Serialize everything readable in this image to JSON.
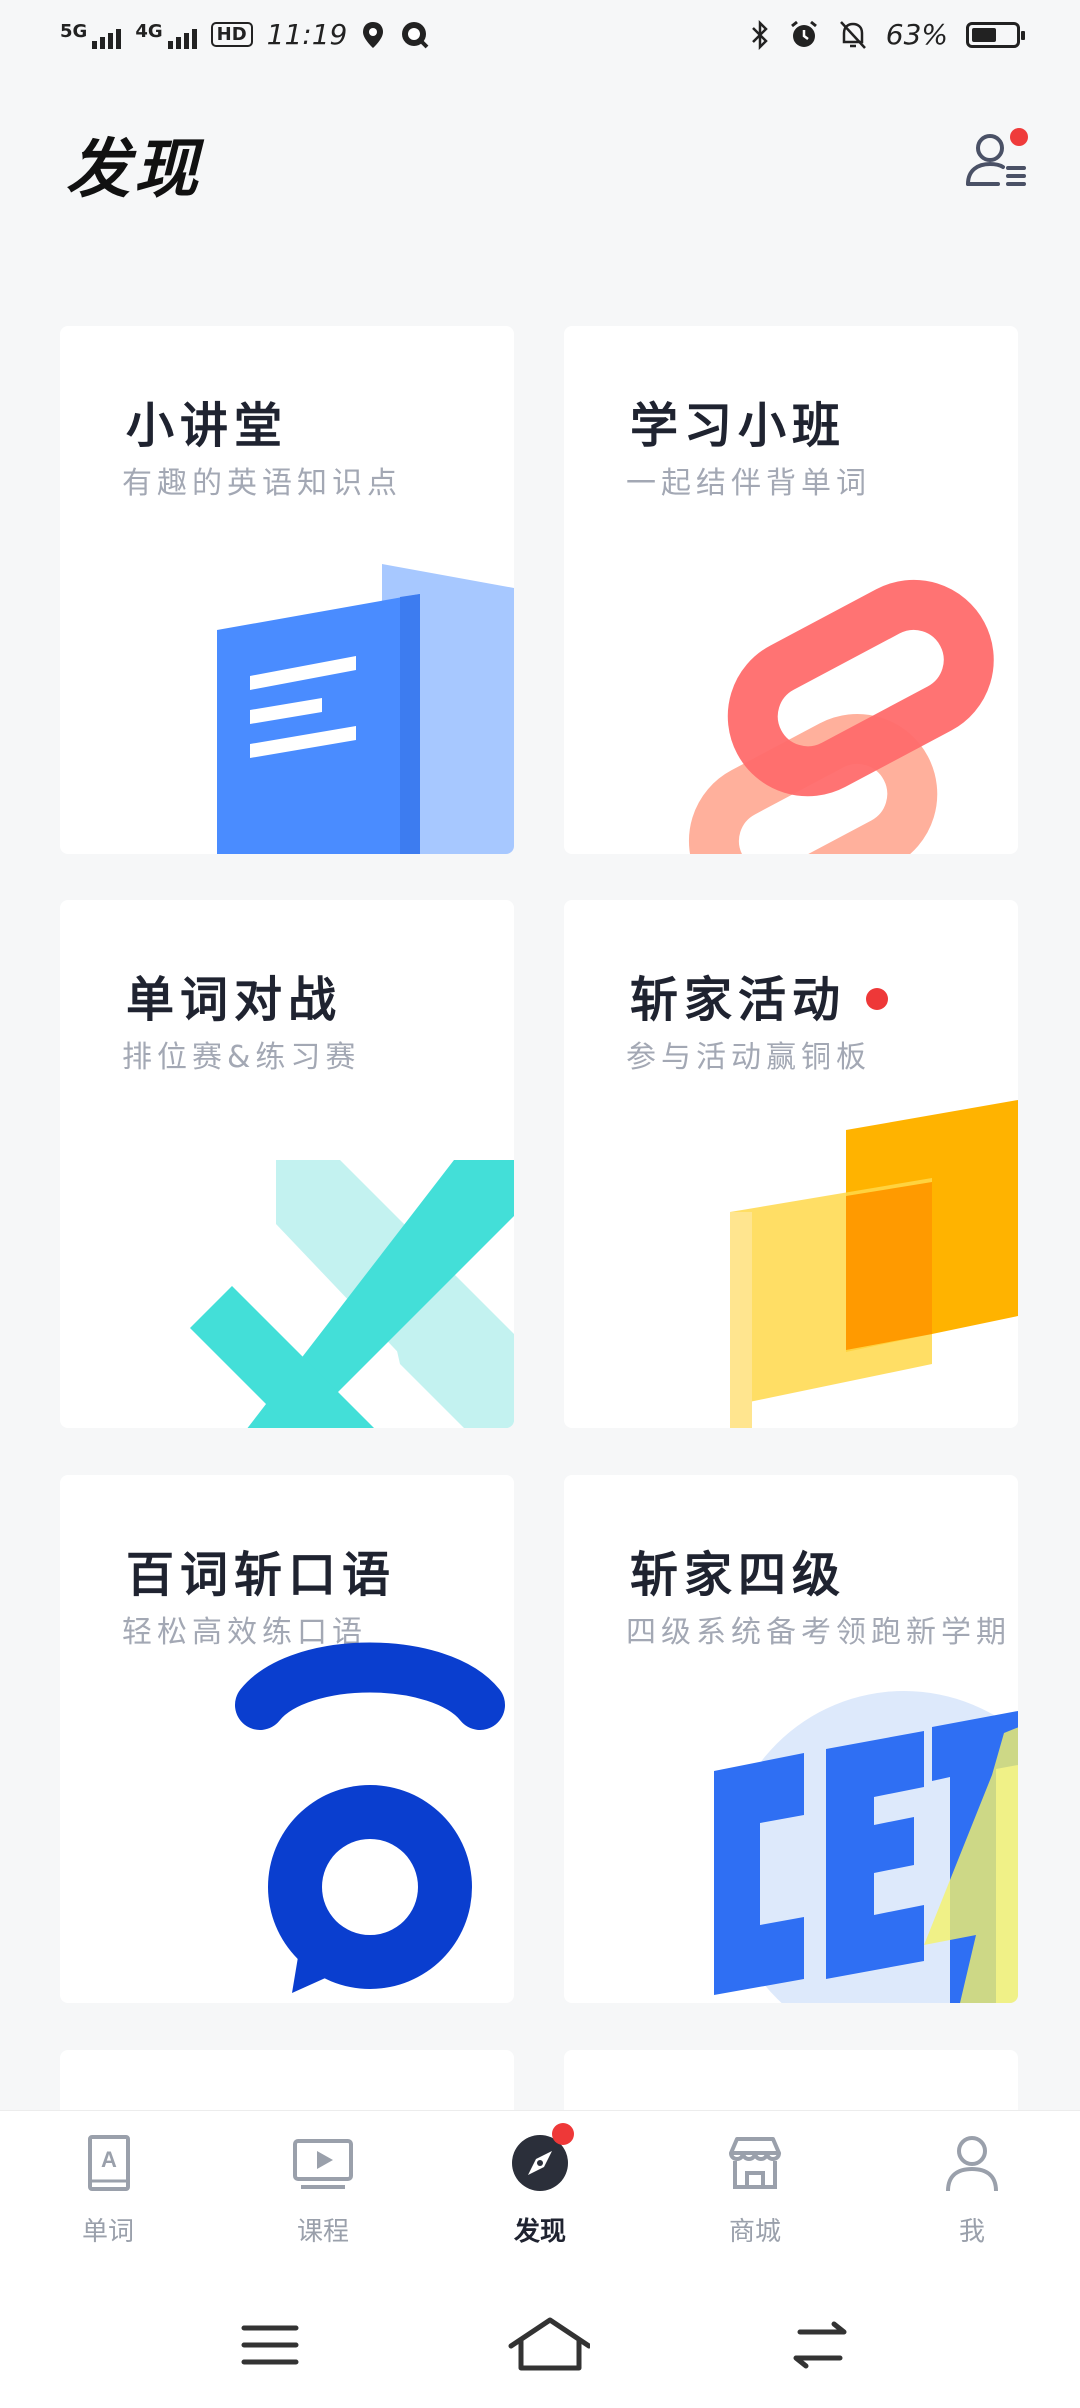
{
  "status_bar": {
    "network1": "5G",
    "network2": "4G",
    "hd": "HD",
    "time": "11:19",
    "battery": "63%",
    "battery_level": 0.63
  },
  "header": {
    "title": "发现"
  },
  "cards": [
    {
      "title": "小讲堂",
      "subtitle": "有趣的英语知识点"
    },
    {
      "title": "学习小班",
      "subtitle": "一起结伴背单词"
    },
    {
      "title": "单词对战",
      "subtitle": "排位赛&练习赛"
    },
    {
      "title": "斩家活动",
      "subtitle": "参与活动赢铜板"
    },
    {
      "title": "百词斩口语",
      "subtitle": "轻松高效练口语"
    },
    {
      "title": "斩家四级",
      "subtitle": "四级系统备考领跑新学期"
    }
  ],
  "bottom_nav": {
    "items": [
      {
        "label": "单词",
        "icon": "book-icon"
      },
      {
        "label": "课程",
        "icon": "video-icon"
      },
      {
        "label": "发现",
        "icon": "compass-icon"
      },
      {
        "label": "商城",
        "icon": "store-icon"
      },
      {
        "label": "我",
        "icon": "person-icon"
      }
    ],
    "active": "发现"
  },
  "colors": {
    "blue": "#4a8cff",
    "coral": "#ff6b6b",
    "cyan": "#43dfd8",
    "yellow": "#ffb300",
    "deep_blue": "#0a3ecf",
    "badge": "#ee3838"
  }
}
